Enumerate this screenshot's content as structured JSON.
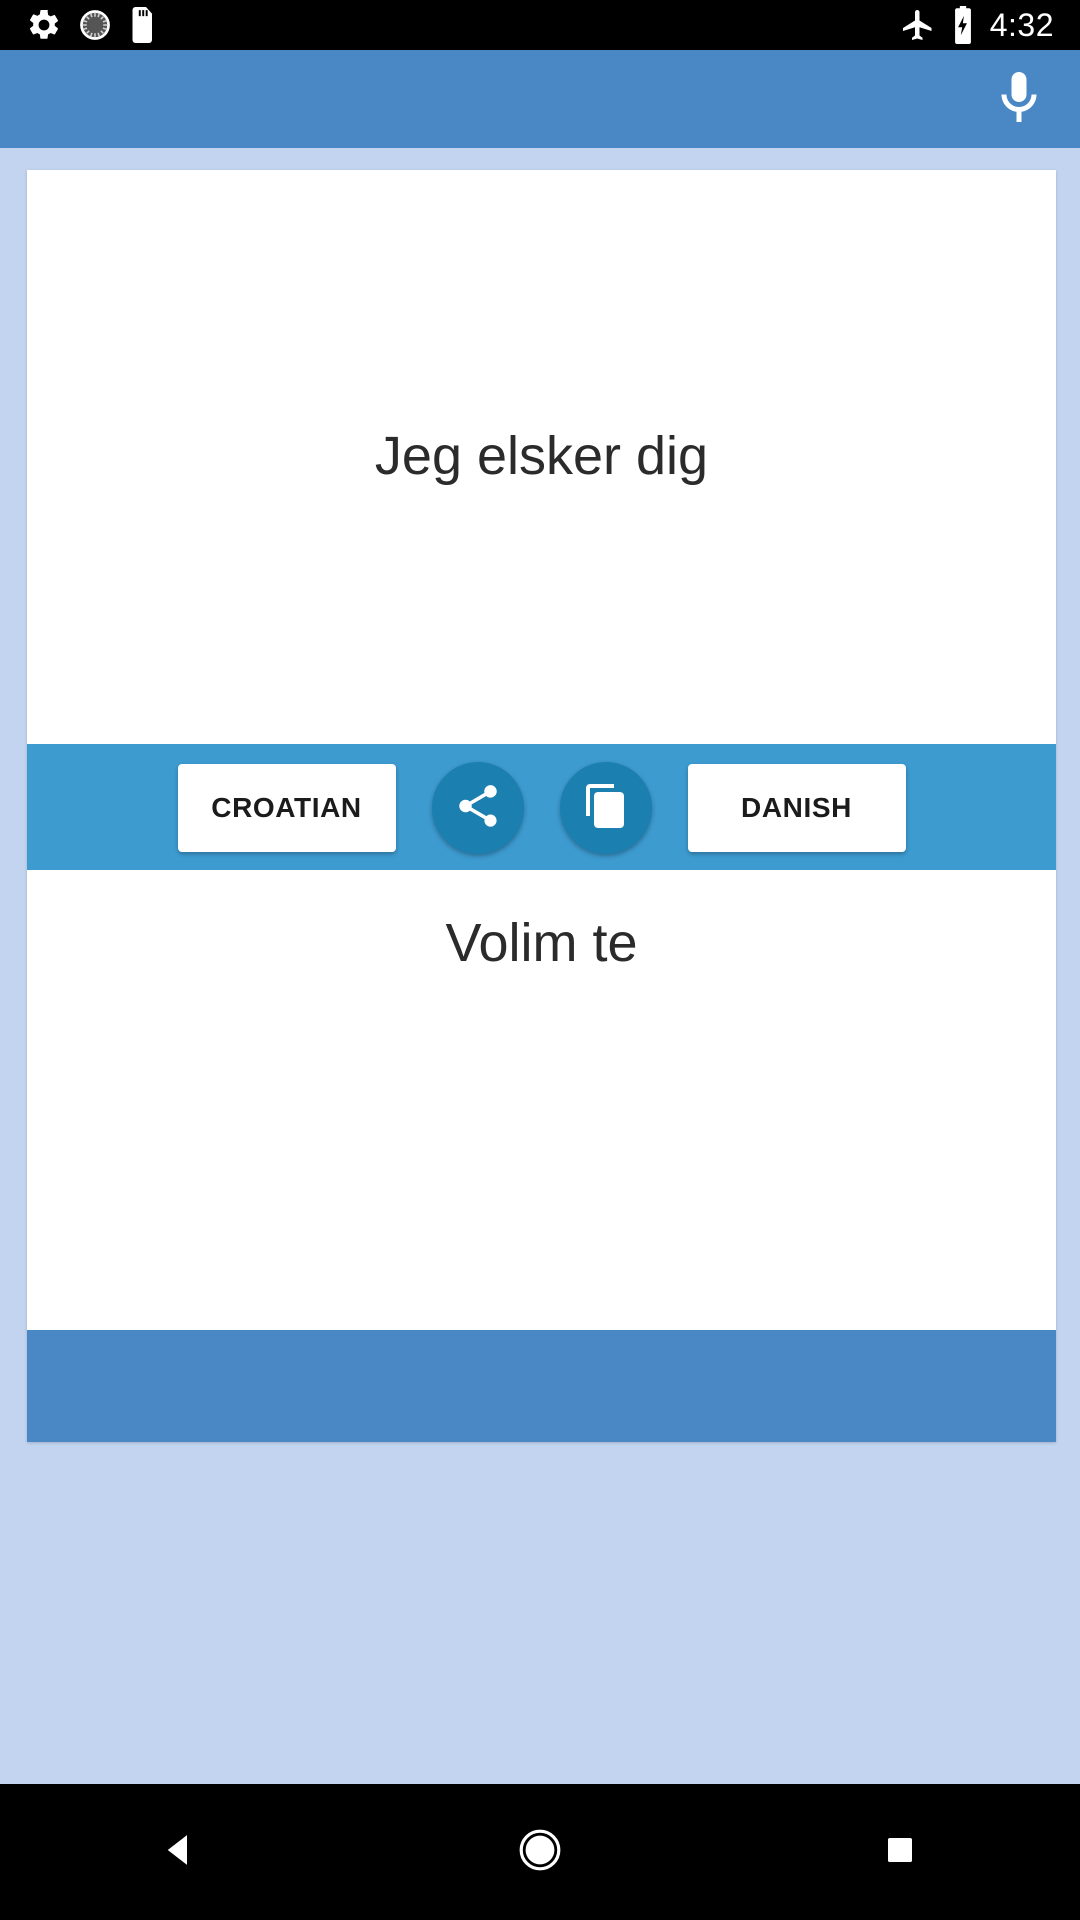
{
  "status_bar": {
    "icons_left": [
      "settings-gear-icon",
      "sync-sunburst-icon",
      "sd-card-icon"
    ],
    "icons_right": [
      "airplane-mode-icon",
      "battery-charging-icon"
    ],
    "time": "4:32"
  },
  "app_bar": {
    "mic_icon": "microphone-icon",
    "background_color": "#4a87c5"
  },
  "translator": {
    "source_text": "Jeg elsker dig",
    "target_text": "Volim te",
    "toolbar": {
      "left_language": "CROATIAN",
      "right_language": "DANISH",
      "share_icon": "share-icon",
      "copy_icon": "copy-icon",
      "background_color": "#3d9bd0",
      "round_button_color": "#1b7fb0"
    },
    "card_background": "#ffffff",
    "footer_color": "#4a87c5"
  },
  "page": {
    "background_color": "#c3d4f0"
  },
  "nav_bar": {
    "back_label": "back-button",
    "home_label": "home-button",
    "recents_label": "recents-button"
  }
}
